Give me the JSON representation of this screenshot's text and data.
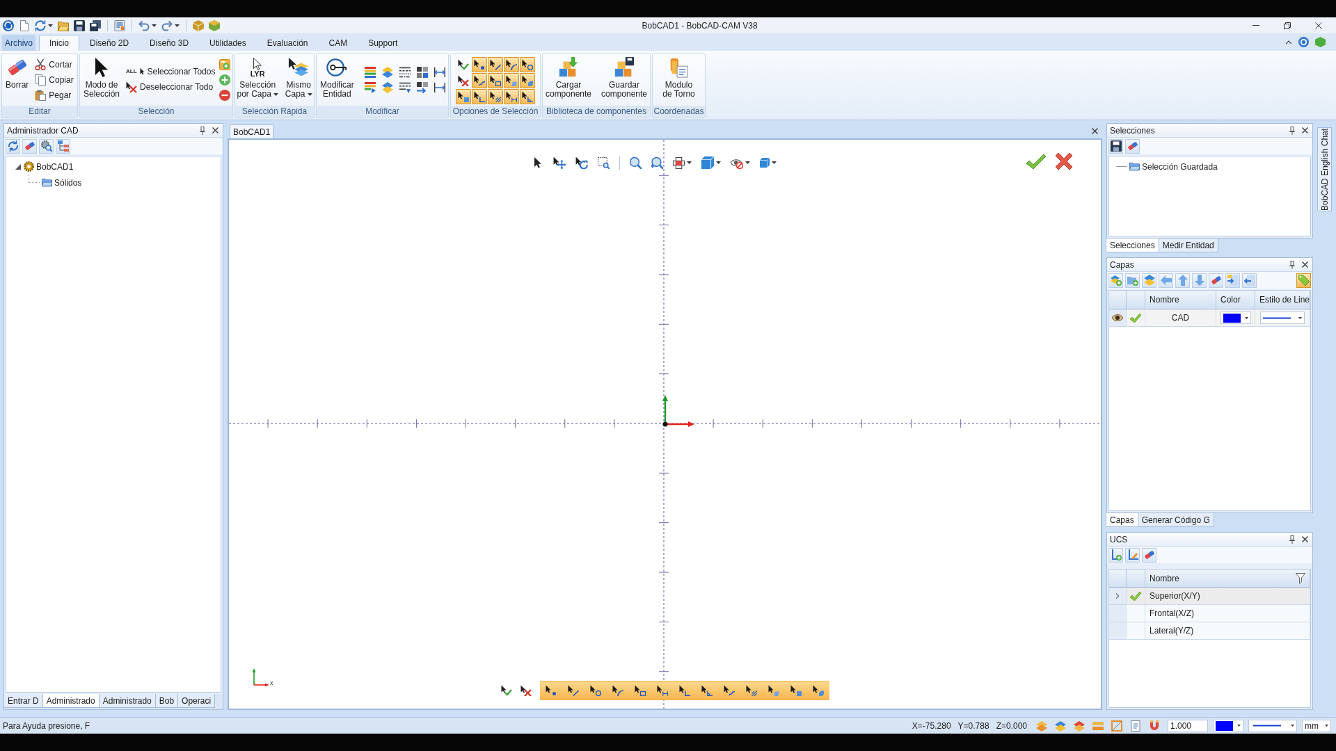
{
  "window": {
    "title": "BobCAD1 - BobCAD-CAM V38"
  },
  "ribbon": {
    "tabs": [
      {
        "label": "Archivo",
        "kind": "file",
        "selected": false
      },
      {
        "label": "Inicio",
        "kind": "page",
        "selected": true
      },
      {
        "label": "Diseño 2D",
        "kind": "page",
        "selected": false
      },
      {
        "label": "Diseño 3D",
        "kind": "page",
        "selected": false
      },
      {
        "label": "Utilidades",
        "kind": "page",
        "selected": false
      },
      {
        "label": "Evaluación",
        "kind": "page",
        "selected": false
      },
      {
        "label": "CAM",
        "kind": "page",
        "selected": false
      },
      {
        "label": "Support",
        "kind": "page",
        "selected": false
      }
    ],
    "groups": [
      {
        "kind": "edit",
        "label": "Editar",
        "large": [
          {
            "label": "Borrar",
            "dropdown": false
          }
        ],
        "small": [
          {
            "label": "Cortar"
          },
          {
            "label": "Copiar"
          },
          {
            "label": "Pegar"
          }
        ]
      },
      {
        "kind": "select",
        "label": "Selección",
        "large": [
          {
            "label": "Modo de\nSelección",
            "dropdown": false
          }
        ],
        "small": [
          {
            "label": "Seleccionar Todos",
            "icon_text": "ALL"
          },
          {
            "label": "Deseleccionar Todo"
          }
        ]
      },
      {
        "kind": "quick",
        "label": "Selección Rápida",
        "large": [
          {
            "label": "Selección\npor Capa",
            "icon_text": "LYR",
            "dropdown": true
          },
          {
            "label": "Mismo\nCapa",
            "dropdown": true
          }
        ]
      },
      {
        "kind": "modify",
        "label": "Modificar",
        "large": [
          {
            "label": "Modificar\nEntidad",
            "dropdown": false
          }
        ]
      },
      {
        "kind": "filters",
        "label": "Opciones de Selección",
        "filters": [
          {
            "on": true
          },
          {
            "on": true
          },
          {
            "on": true
          },
          {
            "on": true
          },
          {
            "on": true
          },
          {
            "on": true
          },
          {
            "on": true
          },
          {
            "on": true
          },
          {
            "on": true
          },
          {
            "on": true
          },
          {
            "on": true
          },
          {
            "on": true
          },
          {
            "on": true
          }
        ]
      },
      {
        "kind": "library",
        "label": "Biblioteca de componentes",
        "large": [
          {
            "label": "Cargar\ncomponente",
            "dropdown": false
          },
          {
            "label": "Guardar\ncomponente",
            "dropdown": false
          }
        ]
      },
      {
        "kind": "coordinates",
        "label": "Coordenadas",
        "large": [
          {
            "label": "Modulo\nde Torno",
            "dropdown": false
          }
        ]
      }
    ]
  },
  "cad_manager": {
    "title": "Administrador CAD",
    "tree": [
      {
        "label": "BobCAD1",
        "expanded": true,
        "children": [
          {
            "label": "Sólidos"
          }
        ]
      }
    ],
    "tabs": [
      {
        "label": "Entrar D",
        "selected": false
      },
      {
        "label": "Administrado",
        "selected": true
      },
      {
        "label": "Administrado",
        "selected": false
      },
      {
        "label": "Bob",
        "selected": false
      },
      {
        "label": "Operaci",
        "selected": false
      }
    ]
  },
  "document": {
    "tabs": [
      {
        "label": "BobCAD1",
        "selected": true
      }
    ],
    "viewport": {
      "axis_label": "x",
      "snap_modes": [
        {
          "on": true
        },
        {
          "on": true
        },
        {
          "on": true
        },
        {
          "on": true
        },
        {
          "on": true
        },
        {
          "on": true
        },
        {
          "on": true
        },
        {
          "on": true
        },
        {
          "on": true
        },
        {
          "on": true
        },
        {
          "on": true
        },
        {
          "on": true
        },
        {
          "on": true
        }
      ]
    }
  },
  "selections_panel": {
    "title": "Selecciones",
    "tree": [
      {
        "label": "Selección Guardada"
      }
    ],
    "tabs": [
      {
        "label": "Selecciones",
        "selected": true
      },
      {
        "label": "Medir Entidad",
        "selected": false
      }
    ]
  },
  "layers_panel": {
    "title": "Capas",
    "columns": [
      "Nombre",
      "Color",
      "Estilo de Line"
    ],
    "rows": [
      {
        "visible": true,
        "active": true,
        "name": "CAD",
        "color": "#0000ff"
      }
    ],
    "tabs": [
      {
        "label": "Capas",
        "selected": true
      },
      {
        "label": "Generar Código G",
        "selected": false
      }
    ]
  },
  "ucs_panel": {
    "title": "UCS",
    "columns": [
      "Nombre"
    ],
    "rows": [
      {
        "name": "Superior(X/Y)",
        "selected": true,
        "active": true
      },
      {
        "name": "Frontal(X/Z)",
        "selected": false,
        "active": false
      },
      {
        "name": "Lateral(Y/Z)",
        "selected": false,
        "active": false
      }
    ]
  },
  "side_tab": {
    "label": "BobCAD English Chat"
  },
  "status_bar": {
    "help": "Para Ayuda presione, F",
    "coordinates": [
      "X=-75.280",
      "Y=0.788",
      "Z=0.000"
    ],
    "scale": "1.000",
    "color": "#0000ff",
    "units": "mm"
  }
}
